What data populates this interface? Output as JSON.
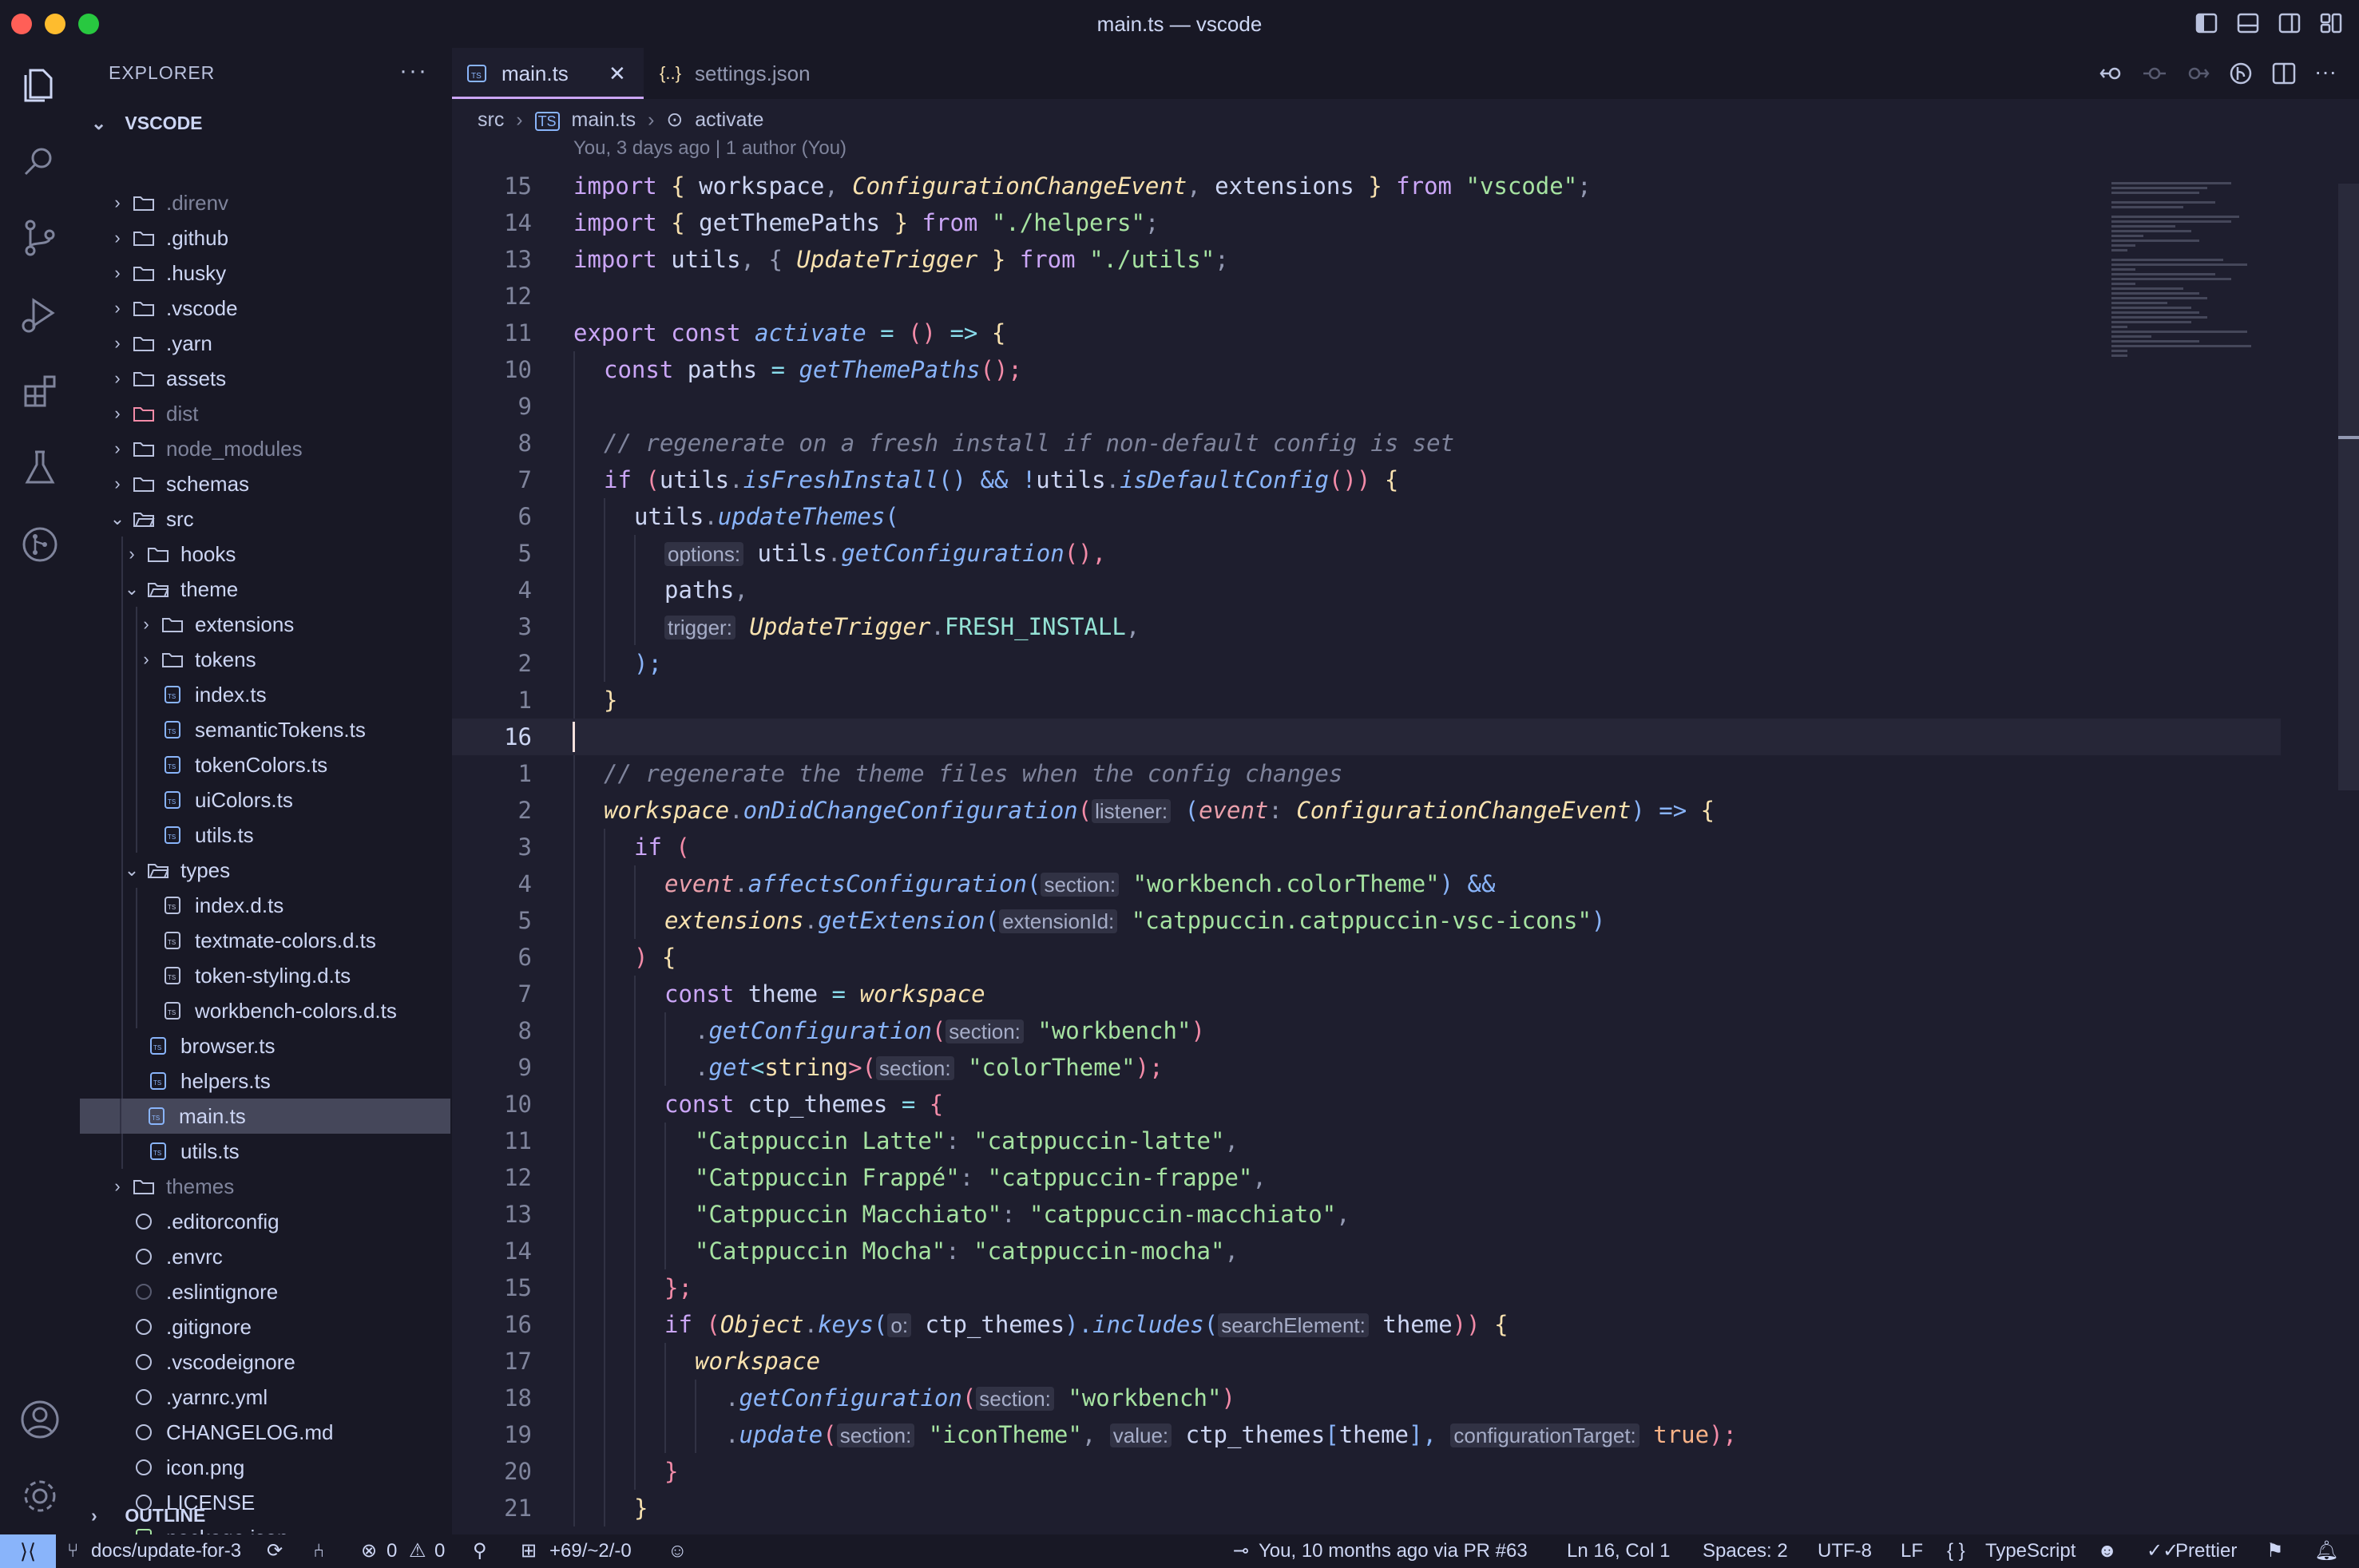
{
  "window": {
    "title": "main.ts — vscode"
  },
  "sidebar": {
    "header": "EXPLORER",
    "more": "···",
    "root": "VSCODE",
    "outline": "OUTLINE",
    "items": [
      {
        "label": ".direnv"
      },
      {
        "label": ".github"
      },
      {
        "label": ".husky"
      },
      {
        "label": ".vscode"
      },
      {
        "label": ".yarn"
      },
      {
        "label": "assets"
      },
      {
        "label": "dist"
      },
      {
        "label": "node_modules"
      },
      {
        "label": "schemas"
      },
      {
        "label": "src"
      },
      {
        "label": "hooks"
      },
      {
        "label": "theme"
      },
      {
        "label": "extensions"
      },
      {
        "label": "tokens"
      },
      {
        "label": "index.ts"
      },
      {
        "label": "semanticTokens.ts"
      },
      {
        "label": "tokenColors.ts"
      },
      {
        "label": "uiColors.ts"
      },
      {
        "label": "utils.ts"
      },
      {
        "label": "types"
      },
      {
        "label": "index.d.ts"
      },
      {
        "label": "textmate-colors.d.ts"
      },
      {
        "label": "token-styling.d.ts"
      },
      {
        "label": "workbench-colors.d.ts"
      },
      {
        "label": "browser.ts"
      },
      {
        "label": "helpers.ts"
      },
      {
        "label": "main.ts"
      },
      {
        "label": "utils.ts"
      },
      {
        "label": "themes"
      },
      {
        "label": ".editorconfig"
      },
      {
        "label": ".envrc"
      },
      {
        "label": ".eslintignore"
      },
      {
        "label": ".gitignore"
      },
      {
        "label": ".vscodeignore"
      },
      {
        "label": ".yarnrc.yml"
      },
      {
        "label": "CHANGELOG.md"
      },
      {
        "label": "icon.png"
      },
      {
        "label": "LICENSE"
      },
      {
        "label": "package.json"
      }
    ]
  },
  "tabs": [
    {
      "label": "main.ts",
      "close": "✕"
    },
    {
      "label": "settings.json"
    }
  ],
  "breadcrumb": [
    "src",
    "main.ts",
    "activate"
  ],
  "blame": "You, 3 days ago | 1 author (You)",
  "line_numbers": [
    "15",
    "14",
    "13",
    "12",
    "11",
    "10",
    "9",
    "8",
    "7",
    "6",
    "5",
    "4",
    "3",
    "2",
    "1",
    "16",
    "1",
    "2",
    "3",
    "4",
    "5",
    "6",
    "7",
    "8",
    "9",
    "10",
    "11",
    "12",
    "13",
    "14",
    "15",
    "16",
    "17",
    "18",
    "19",
    "20",
    "21"
  ],
  "code": {
    "l0": [
      "import",
      " { ",
      "workspace",
      ", ",
      "ConfigurationChangeEvent",
      ", ",
      "extensions",
      " } ",
      "from",
      " ",
      "\"vscode\"",
      ";"
    ],
    "l1": [
      "import",
      " { ",
      "getThemePaths",
      " } ",
      "from",
      " ",
      "\"./helpers\"",
      ";"
    ],
    "l2": [
      "import",
      " ",
      "utils",
      ", { ",
      "UpdateTrigger",
      " } ",
      "from",
      " ",
      "\"./utils\"",
      ";"
    ],
    "l4": [
      "export",
      " ",
      "const",
      " ",
      "activate",
      " = ",
      "()",
      " => ",
      "{"
    ],
    "l5": [
      "const",
      " ",
      "paths",
      " = ",
      "getThemePaths",
      "();"
    ],
    "l7": "// regenerate on a fresh install if non-default config is set",
    "l8": [
      "if",
      " (",
      "utils",
      ".",
      "isFreshInstall",
      "() && !",
      "utils",
      ".",
      "isDefaultConfig",
      "()) ",
      "{"
    ],
    "l9": [
      "utils",
      ".",
      "updateThemes",
      "("
    ],
    "l10": [
      "options:",
      " ",
      "utils",
      ".",
      "getConfiguration",
      "(),"
    ],
    "l11": [
      "paths",
      ","
    ],
    "l12": [
      "trigger:",
      " ",
      "UpdateTrigger",
      ".",
      "FRESH_INSTALL",
      ","
    ],
    "l13": [
      ");"
    ],
    "l14": [
      "}"
    ],
    "l16": "// regenerate the theme files when the config changes",
    "l17": [
      "workspace",
      ".",
      "onDidChangeConfiguration",
      "(",
      "listener:",
      " (",
      "event",
      ": ",
      "ConfigurationChangeEvent",
      ") => ",
      "{"
    ],
    "l18": [
      "if",
      " ("
    ],
    "l19": [
      "event",
      ".",
      "affectsConfiguration",
      "(",
      "section:",
      " ",
      "\"workbench.colorTheme\"",
      ") &&"
    ],
    "l20": [
      "extensions",
      ".",
      "getExtension",
      "(",
      "extensionId:",
      " ",
      "\"catppuccin.catppuccin-vsc-icons\"",
      ")"
    ],
    "l21": [
      ") ",
      "{"
    ],
    "l22": [
      "const",
      " ",
      "theme",
      " = ",
      "workspace"
    ],
    "l23": [
      ".",
      "getConfiguration",
      "(",
      "section:",
      " ",
      "\"workbench\"",
      ")"
    ],
    "l24": [
      ".",
      "get",
      "<",
      "string",
      ">(",
      "section:",
      " ",
      "\"colorTheme\"",
      ");"
    ],
    "l25": [
      "const",
      " ",
      "ctp_themes",
      " = ",
      "{"
    ],
    "l26": [
      "\"Catppuccin Latte\"",
      ": ",
      "\"catppuccin-latte\"",
      ","
    ],
    "l27": [
      "\"Catppuccin Frappé\"",
      ": ",
      "\"catppuccin-frappe\"",
      ","
    ],
    "l28": [
      "\"Catppuccin Macchiato\"",
      ": ",
      "\"catppuccin-macchiato\"",
      ","
    ],
    "l29": [
      "\"Catppuccin Mocha\"",
      ": ",
      "\"catppuccin-mocha\"",
      ","
    ],
    "l30": [
      "};"
    ],
    "l31": [
      "if",
      " (",
      "Object",
      ".",
      "keys",
      "(",
      "o:",
      " ",
      "ctp_themes",
      ").",
      "includes",
      "(",
      "searchElement:",
      " ",
      "theme",
      ")) ",
      "{"
    ],
    "l32": [
      "workspace"
    ],
    "l33": [
      ".",
      "getConfiguration",
      "(",
      "section:",
      " ",
      "\"workbench\"",
      ")"
    ],
    "l34": [
      ".",
      "update",
      "(",
      "section:",
      " ",
      "\"iconTheme\"",
      ", ",
      "value:",
      " ",
      "ctp_themes",
      "[",
      "theme",
      "], ",
      "configurationTarget:",
      " ",
      "true",
      ");"
    ],
    "l35": [
      "}"
    ],
    "l36": [
      "}"
    ]
  },
  "status": {
    "branch": "docs/update-for-3",
    "errors": "0",
    "warnings": "0",
    "changes": "+69/~2/-0",
    "blame": "You, 10 months ago via PR #63",
    "position": "Ln 16, Col 1",
    "spaces": "Spaces: 2",
    "encoding": "UTF-8",
    "eol": "LF",
    "language": "TypeScript",
    "formatter": "Prettier"
  },
  "colors": {
    "background": "#1e1e2e",
    "mantle": "#181825",
    "mauve": "#cba6f7",
    "green": "#a6e3a1",
    "blue": "#89b4fa",
    "yellow": "#f9e2af",
    "overlay": "#7f849c"
  }
}
